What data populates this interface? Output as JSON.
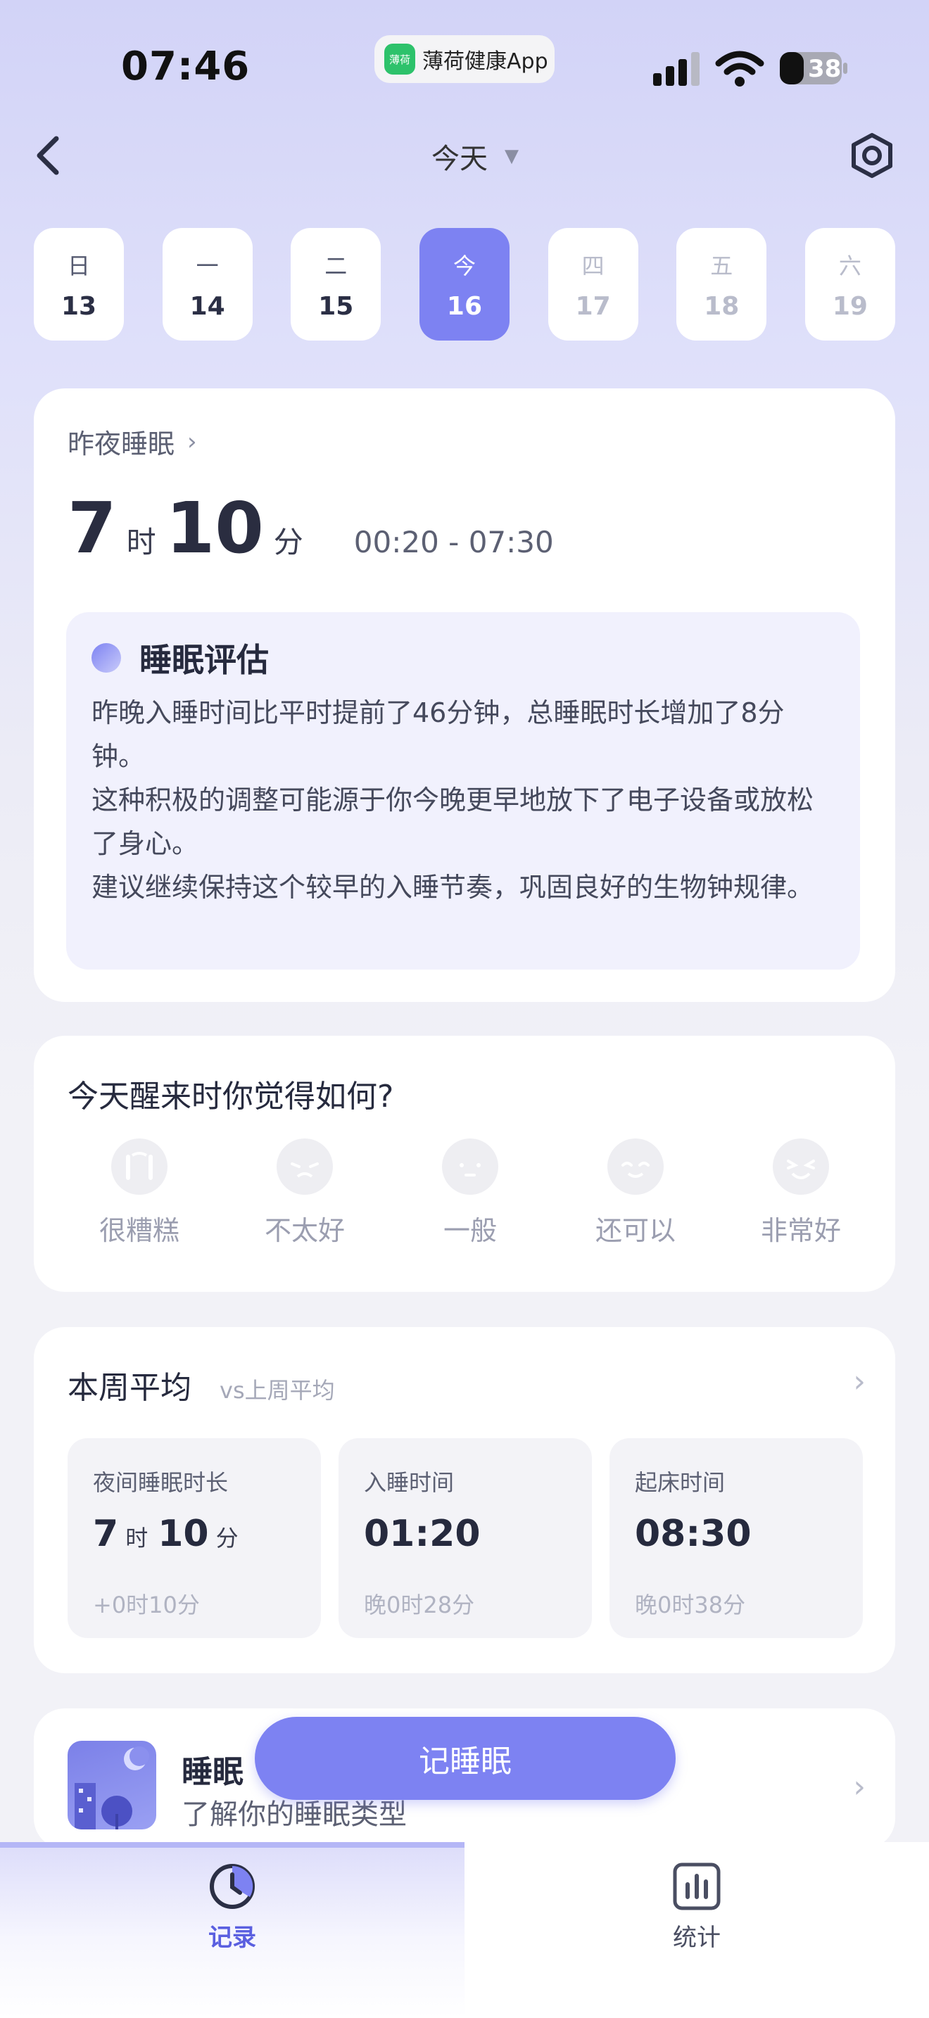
{
  "status_bar": {
    "time": "07:46",
    "app_pill_logo": "薄荷",
    "app_pill_name": "薄荷健康App",
    "battery": "38"
  },
  "nav": {
    "title": "今天",
    "caret": "▼"
  },
  "week": [
    {
      "weekday": "日",
      "date": "13"
    },
    {
      "weekday": "一",
      "date": "14"
    },
    {
      "weekday": "二",
      "date": "15"
    },
    {
      "weekday": "今",
      "date": "16"
    },
    {
      "weekday": "四",
      "date": "17"
    },
    {
      "weekday": "五",
      "date": "18"
    },
    {
      "weekday": "六",
      "date": "19"
    }
  ],
  "last_night": {
    "heading": "昨夜睡眠",
    "hours": "7",
    "hours_unit": "时",
    "minutes": "10",
    "minutes_unit": "分",
    "range": "00:20 - 07:30",
    "assessment_title": "睡眠评估",
    "assessment_lines": [
      "昨晚入睡时间比平时提前了46分钟，总睡眠时长增加了8分钟。",
      "这种积极的调整可能源于你今晚更早地放下了电子设备或放松了身心。",
      "建议继续保持这个较早的入睡节奏，巩固良好的生物钟规律。"
    ]
  },
  "feeling": {
    "question": "今天醒来时你觉得如何?",
    "options": [
      "很糟糕",
      "不太好",
      "一般",
      "还可以",
      "非常好"
    ]
  },
  "weekly_average": {
    "title": "本周平均",
    "subtitle": "vs上周平均",
    "stats": [
      {
        "label": "夜间睡眠时长",
        "hours": "7",
        "hours_unit": "时",
        "minutes": "10",
        "minutes_unit": "分",
        "delta": "+0时10分"
      },
      {
        "label": "入睡时间",
        "value": "01:20",
        "delta": "晚0时28分"
      },
      {
        "label": "起床时间",
        "value": "08:30",
        "delta": "晚0时38分"
      }
    ]
  },
  "sleep_type": {
    "title": "睡眠类型",
    "title_visible": "睡眠",
    "subtitle": "了解你的睡眠类型"
  },
  "record_button": "记睡眠",
  "tabs": [
    {
      "label": "记录",
      "icon": "clock-icon",
      "active": true
    },
    {
      "label": "统计",
      "icon": "bar-chart-icon",
      "active": false
    }
  ],
  "colors": {
    "accent": "#7d82f2",
    "tab_active": "#5a5fe0"
  }
}
